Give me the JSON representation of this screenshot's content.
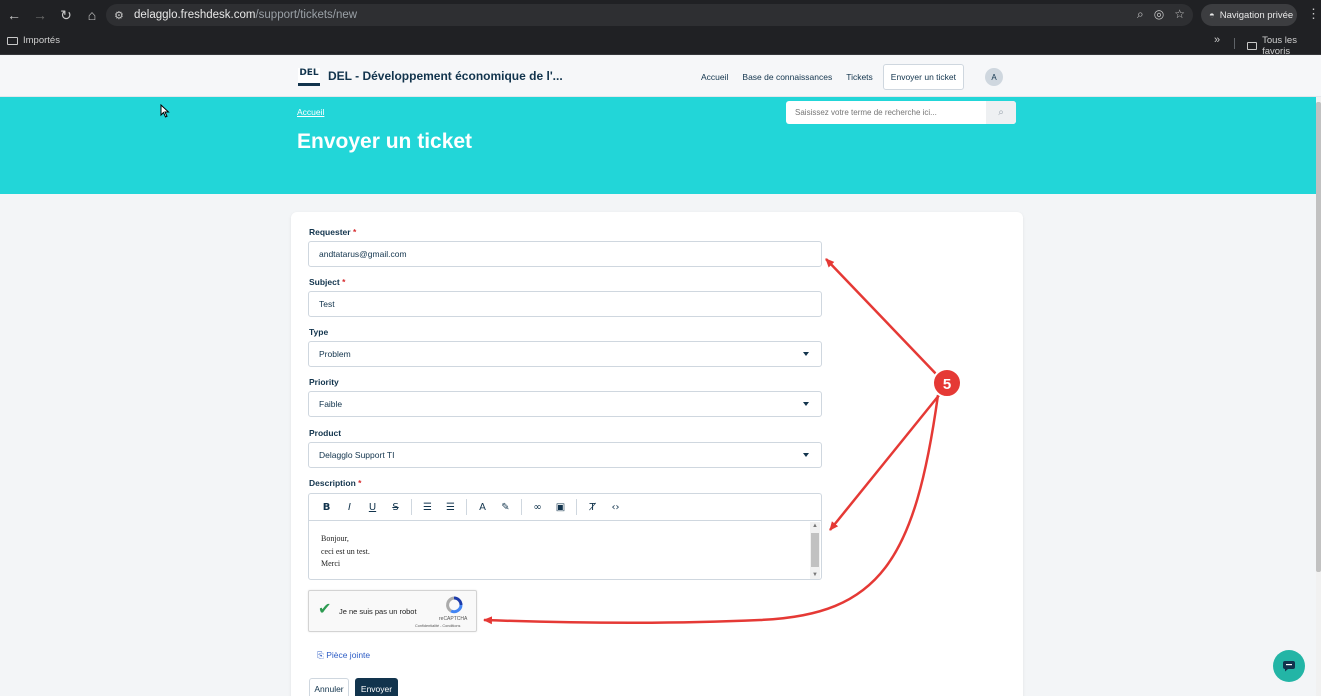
{
  "browser": {
    "url_host": "delagglo.freshdesk.com",
    "url_path": "/support/tickets/new",
    "private_label": "Navigation privée",
    "bookmark_left": "Importés",
    "bookmark_right": "Tous les favoris"
  },
  "header": {
    "logo_text": "DEL",
    "site_title": "DEL - Développement économique de l'...",
    "nav": [
      "Accueil",
      "Base de connaissances",
      "Tickets",
      "Envoyer un ticket"
    ],
    "avatar_initial": "A"
  },
  "banner": {
    "breadcrumb": "Accueil",
    "title": "Envoyer un ticket",
    "search_placeholder": "Saisissez votre terme de recherche ici..."
  },
  "form": {
    "requester": {
      "label": "Requester",
      "value": "andtatarus@gmail.com"
    },
    "subject": {
      "label": "Subject",
      "value": "Test"
    },
    "type": {
      "label": "Type",
      "value": "Problem"
    },
    "priority": {
      "label": "Priority",
      "value": "Faible"
    },
    "product": {
      "label": "Product",
      "value": "Delagglo Support TI"
    },
    "description": {
      "label": "Description",
      "lines": [
        "Bonjour,",
        "ceci est un test.",
        "Merci"
      ]
    },
    "required_mark": "*",
    "captcha": {
      "label": "Je ne suis pas un robot",
      "brand": "reCAPTCHA",
      "terms": "Confidentialité - Conditions"
    },
    "attachment": "Pièce jointe",
    "cancel": "Annuler",
    "submit": "Envoyer"
  },
  "annotation": {
    "number": "5",
    "color": "#e53935"
  }
}
